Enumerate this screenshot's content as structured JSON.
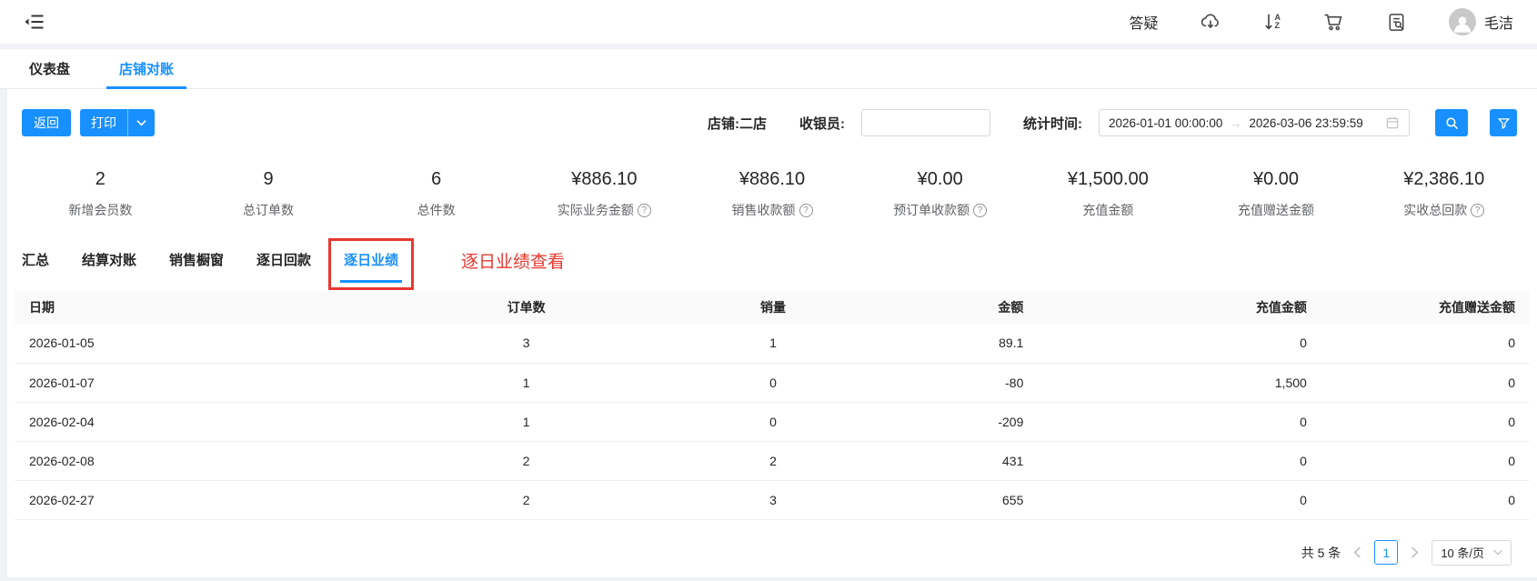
{
  "topbar": {
    "help_label": "答疑",
    "user_name": "毛洁"
  },
  "icons": {
    "help_glyph": "?",
    "sort_a": "A",
    "sort_z": "Z",
    "date_arrow": "→"
  },
  "nav_tabs": [
    {
      "label": "仪表盘"
    },
    {
      "label": "店铺对账"
    }
  ],
  "toolbar": {
    "back_label": "返回",
    "print_label": "打印",
    "store_label": "店铺:二店",
    "cashier_label": "收银员:",
    "cashier_value": "",
    "time_label": "统计时间:",
    "time_start": "2026-01-01 00:00:00",
    "time_end": "2026-03-06 23:59:59"
  },
  "stats": [
    {
      "value": "2",
      "label": "新增会员数"
    },
    {
      "value": "9",
      "label": "总订单数"
    },
    {
      "value": "6",
      "label": "总件数"
    },
    {
      "value": "¥886.10",
      "label": "实际业务金额"
    },
    {
      "value": "¥886.10",
      "label": "销售收款额"
    },
    {
      "value": "¥0.00",
      "label": "预订单收款额"
    },
    {
      "value": "¥1,500.00",
      "label": "充值金额"
    },
    {
      "value": "¥0.00",
      "label": "充值赠送金额"
    },
    {
      "value": "¥2,386.10",
      "label": "实收总回款"
    }
  ],
  "sub_tabs": [
    {
      "label": "汇总"
    },
    {
      "label": "结算对账"
    },
    {
      "label": "销售橱窗"
    },
    {
      "label": "逐日回款"
    },
    {
      "label": "逐日业绩"
    }
  ],
  "annotation_text": "逐日业绩查看",
  "table": {
    "columns": [
      "日期",
      "订单数",
      "销量",
      "金额",
      "充值金额",
      "充值赠送金额"
    ],
    "rows": [
      [
        "2026-01-05",
        "3",
        "1",
        "89.1",
        "0",
        "0"
      ],
      [
        "2026-01-07",
        "1",
        "0",
        "-80",
        "1,500",
        "0"
      ],
      [
        "2026-02-04",
        "1",
        "0",
        "-209",
        "0",
        "0"
      ],
      [
        "2026-02-08",
        "2",
        "2",
        "431",
        "0",
        "0"
      ],
      [
        "2026-02-27",
        "2",
        "3",
        "655",
        "0",
        "0"
      ]
    ]
  },
  "pagination": {
    "total_label": "共 5 条",
    "current_page": "1",
    "page_size_label": "10 条/页"
  },
  "colors": {
    "accent": "#1890ff",
    "annotation_red": "#e8382f"
  }
}
